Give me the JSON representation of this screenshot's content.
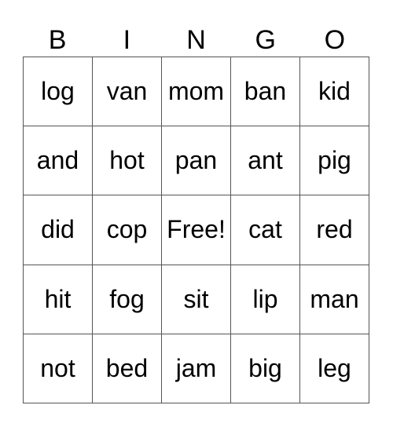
{
  "header": [
    "B",
    "I",
    "N",
    "G",
    "O"
  ],
  "rows": [
    [
      "log",
      "van",
      "mom",
      "ban",
      "kid"
    ],
    [
      "and",
      "hot",
      "pan",
      "ant",
      "pig"
    ],
    [
      "did",
      "cop",
      "Free!",
      "cat",
      "red"
    ],
    [
      "hit",
      "fog",
      "sit",
      "lip",
      "man"
    ],
    [
      "not",
      "bed",
      "jam",
      "big",
      "leg"
    ]
  ]
}
